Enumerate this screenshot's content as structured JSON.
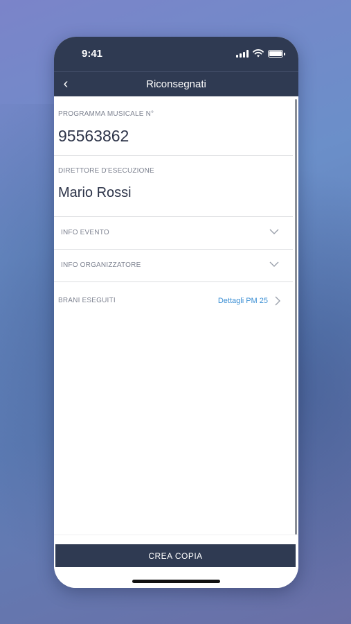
{
  "status_bar": {
    "time": "9:41",
    "icons": [
      "signal-icon",
      "wifi-icon",
      "battery-icon"
    ]
  },
  "nav": {
    "back_icon": "chevron-left-icon",
    "title": "Riconsegnati"
  },
  "fields": {
    "program_label": "PROGRAMMA MUSICALE N°",
    "program_value": "95563862",
    "director_label": "DIRETTORE D'ESECUZIONE",
    "director_value": "Mario Rossi"
  },
  "accordions": {
    "event_label": "INFO EVENTO",
    "organizer_label": "INFO ORGANIZZATORE"
  },
  "performed": {
    "label": "BRANI ESEGUITI",
    "link_label": "Dettagli PM 25"
  },
  "footer": {
    "button_label": "CREA COPIA"
  },
  "colors": {
    "header": "#2f3a52",
    "link": "#3b8fd4",
    "text": "#2c3348",
    "label": "#7d8290"
  }
}
